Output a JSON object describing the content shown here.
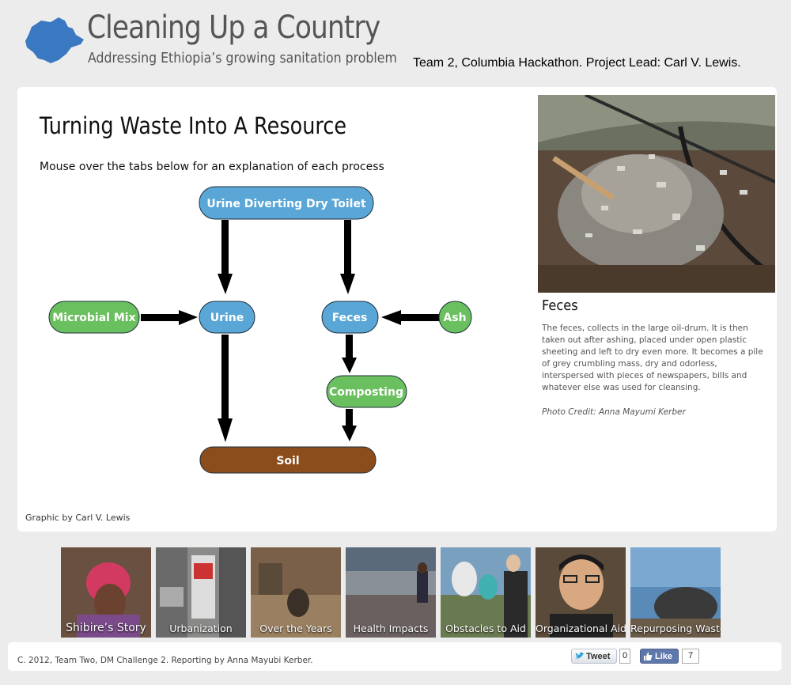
{
  "header": {
    "title": "Cleaning Up a Country",
    "subtitle": "Addressing Ethiopia’s growing sanitation problem",
    "team_credit": "Team 2, Columbia Hackathon. Project Lead: Carl V. Lewis.",
    "logo_icon": "ethiopia-map-icon",
    "logo_color": "#3a78c2"
  },
  "main": {
    "title": "Turning Waste Into A Resource",
    "instructions": "Mouse over the tabs below for an explanation of each process",
    "graphic_credit": "Graphic by Carl V. Lewis",
    "colors": {
      "blue_node": "#5aa6d6",
      "green_node": "#6abf5e",
      "brown_node": "#8b4d1c",
      "arrow": "#000000"
    },
    "flow_nodes": {
      "toilet": "Urine Diverting Dry Toilet",
      "urine": "Urine",
      "feces": "Feces",
      "microbial": "Microbial Mix",
      "ash": "Ash",
      "composting": "Composting",
      "soil": "Soil"
    }
  },
  "detail": {
    "title": "Feces",
    "body": "The feces, collects in the large oil-drum. It is then taken out after ashing, placed under open plastic sheeting and left to dry even more. It becomes a pile of grey crumbling mass, dry and odorless, interspersed with pieces of newspapers, bills and whatever else was used for cleansing.",
    "credit": "Photo Credit: Anna Mayumi Kerber"
  },
  "thumbnails": [
    {
      "label": "Shibire’s Story"
    },
    {
      "label": "Urbanization"
    },
    {
      "label": "Over the Years"
    },
    {
      "label": "Health Impacts"
    },
    {
      "label": "Obstacles to Aid"
    },
    {
      "label": "Organizational Aid"
    },
    {
      "label": "Repurposing Waste"
    }
  ],
  "footer": {
    "copyright": "C. 2012, Team Two, DM Challenge 2. Reporting by Anna Mayubi Kerber.",
    "tweet_label": "Tweet",
    "tweet_count": "0",
    "like_label": "Like",
    "like_count": "7"
  }
}
